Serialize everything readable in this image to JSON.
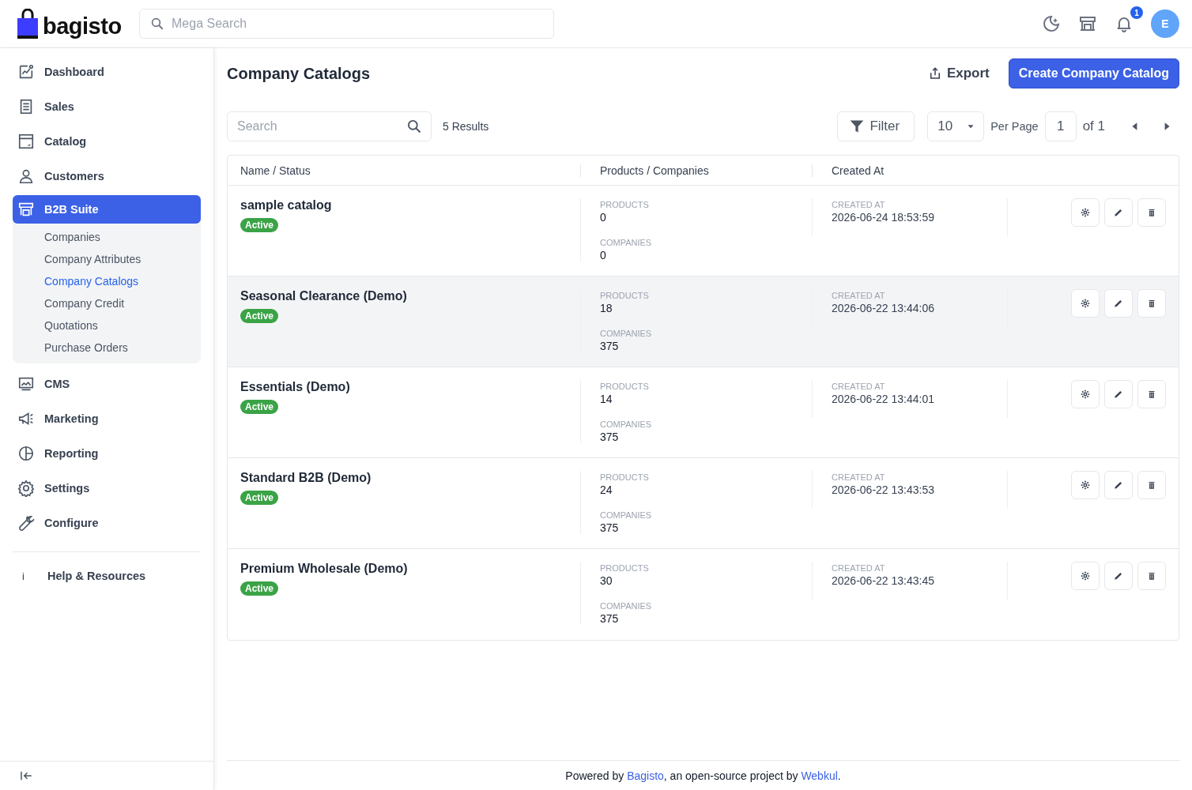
{
  "header": {
    "logo": "bagisto",
    "search": {
      "placeholder": "Mega Search"
    },
    "notification_count": "1",
    "avatar": "E"
  },
  "sidebar": {
    "items": [
      {
        "label": "Dashboard",
        "selected": false
      },
      {
        "label": "Sales",
        "selected": false
      },
      {
        "label": "Catalog",
        "selected": false
      },
      {
        "label": "Customers",
        "selected": false
      },
      {
        "label": "B2B Suite",
        "selected": true,
        "expanded": true,
        "children": [
          {
            "label": "Companies",
            "selected": false
          },
          {
            "label": "Company Attributes",
            "selected": false
          },
          {
            "label": "Company Catalogs",
            "selected": true
          },
          {
            "label": "Company Credit",
            "selected": false
          },
          {
            "label": "Quotations",
            "selected": false
          },
          {
            "label": "Purchase Orders",
            "selected": false
          }
        ]
      },
      {
        "label": "CMS",
        "selected": false
      },
      {
        "label": "Marketing",
        "selected": false
      },
      {
        "label": "Reporting",
        "selected": false
      },
      {
        "label": "Settings",
        "selected": false
      },
      {
        "label": "Configure",
        "selected": false
      }
    ],
    "help": {
      "icon": "i",
      "label": "Help & Resources"
    }
  },
  "page": {
    "title": "Company Catalogs",
    "export": "Export",
    "create": "Create Company Catalog"
  },
  "toolbar": {
    "search": {
      "placeholder": "Search"
    },
    "results": "5 Results",
    "filter": "Filter",
    "per_page_value": "10",
    "per_page_label": "Per Page",
    "page": "1",
    "of": "of 1"
  },
  "table": {
    "columns": [
      "Name / Status",
      "Products / Companies",
      "Created At"
    ],
    "rows": [
      {
        "name": "sample catalog",
        "status": "Active",
        "products_label": "PRODUCTS",
        "products": "0",
        "companies_label": "COMPANIES",
        "companies": "0",
        "created_label": "CREATED AT",
        "created": "2026-06-24 18:53:59",
        "highlighted": false
      },
      {
        "name": "Seasonal Clearance (Demo)",
        "status": "Active",
        "products_label": "PRODUCTS",
        "products": "18",
        "companies_label": "COMPANIES",
        "companies": "375",
        "created_label": "CREATED AT",
        "created": "2026-06-22 13:44:06",
        "highlighted": true
      },
      {
        "name": "Essentials (Demo)",
        "status": "Active",
        "products_label": "PRODUCTS",
        "products": "14",
        "companies_label": "COMPANIES",
        "companies": "375",
        "created_label": "CREATED AT",
        "created": "2026-06-22 13:44:01",
        "highlighted": false
      },
      {
        "name": "Standard B2B (Demo)",
        "status": "Active",
        "products_label": "PRODUCTS",
        "products": "24",
        "companies_label": "COMPANIES",
        "companies": "375",
        "created_label": "CREATED AT",
        "created": "2026-06-22 13:43:53",
        "highlighted": false
      },
      {
        "name": "Premium Wholesale (Demo)",
        "status": "Active",
        "products_label": "PRODUCTS",
        "products": "30",
        "companies_label": "COMPANIES",
        "companies": "375",
        "created_label": "CREATED AT",
        "created": "2026-06-22 13:43:45",
        "highlighted": false
      }
    ]
  },
  "footer": {
    "prefix": "Powered by ",
    "link_1": "Bagisto",
    "middle": ", an open-source project by ",
    "link_2": "Webkul",
    "suffix": "."
  }
}
